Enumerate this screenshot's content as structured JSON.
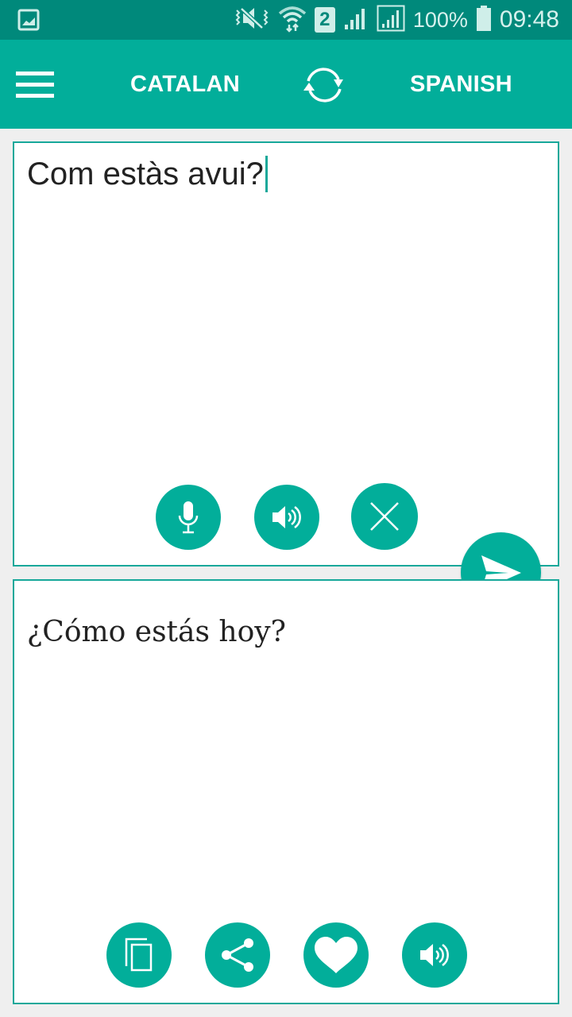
{
  "status_bar": {
    "battery": "100%",
    "time": "09:48",
    "sim_slot": "2",
    "icons": [
      "gallery-notification-icon",
      "vibrate-mute-icon",
      "wifi-icon",
      "sim-2-icon",
      "signal-icon",
      "signal-roaming-icon",
      "battery-icon"
    ]
  },
  "app_bar": {
    "menu_icon": "hamburger-menu-icon",
    "source_language": "CATALAN",
    "swap_icon": "swap-languages-icon",
    "target_language": "SPANISH"
  },
  "input_panel": {
    "text": "Com estàs avui?",
    "buttons": [
      {
        "name": "microphone",
        "icon": "microphone-icon"
      },
      {
        "name": "speak-input",
        "icon": "speaker-icon"
      },
      {
        "name": "clear",
        "icon": "close-icon"
      }
    ]
  },
  "translate_button": {
    "icon": "send-icon"
  },
  "output_panel": {
    "text": "¿Cómo estás hoy?",
    "buttons": [
      {
        "name": "copy",
        "icon": "copy-icon"
      },
      {
        "name": "share",
        "icon": "share-icon"
      },
      {
        "name": "favorite",
        "icon": "heart-icon"
      },
      {
        "name": "speak-output",
        "icon": "speaker-icon"
      }
    ]
  },
  "colors": {
    "status_bar": "#00897b",
    "accent": "#02ae9a",
    "border": "#17a89a",
    "background": "#efefef"
  }
}
